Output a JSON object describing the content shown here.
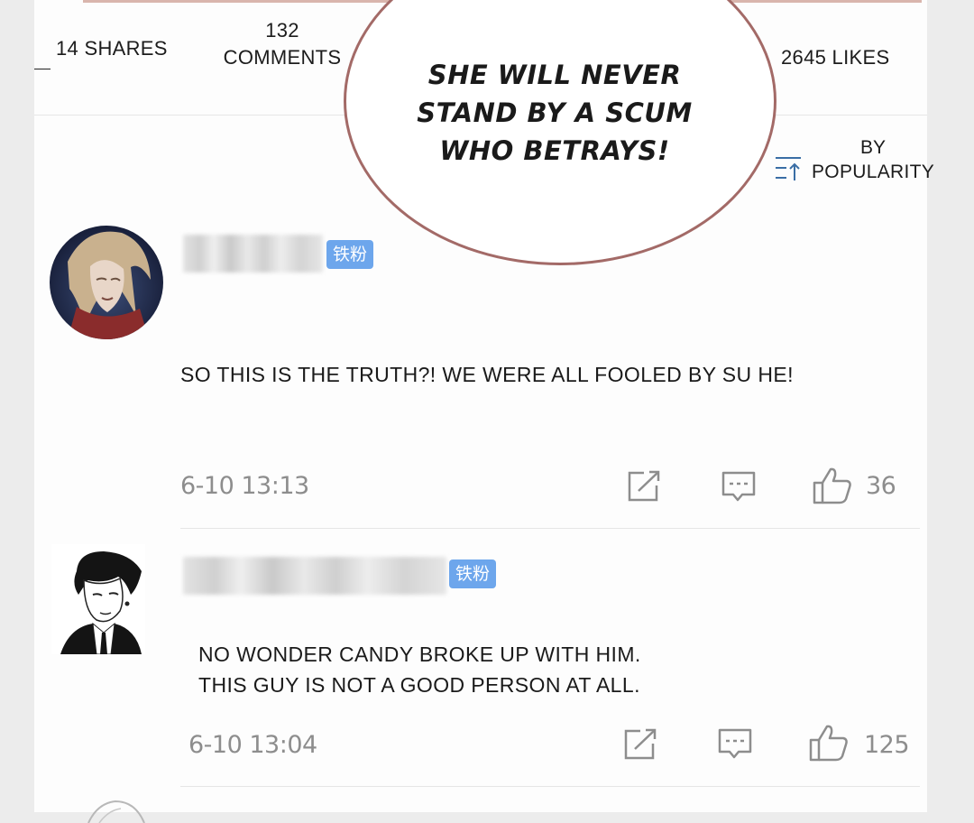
{
  "stats": {
    "shares": "14 SHARES",
    "comments_count": "132",
    "comments_label": "COMMENTS",
    "likes": "2645 LIKES"
  },
  "speech_bubble": {
    "line1": "SHE WILL NEVER",
    "line2": "STAND BY A SCUM",
    "line3": "WHO BETRAYS!"
  },
  "sort": {
    "by": "BY",
    "label": "POPULARITY",
    "icon": "sort-icon"
  },
  "comments": [
    {
      "badge": "铁粉",
      "text": "SO THIS IS THE TRUTH?! WE WERE ALL FOOLED BY SU HE!",
      "timestamp": "6-10 13:13",
      "likes": "36"
    },
    {
      "badge": "铁粉",
      "text_line1": "NO WONDER CANDY BROKE UP WITH HIM.",
      "text_line2": "THIS GUY IS NOT A GOOD PERSON AT ALL.",
      "timestamp": "6-10 13:04",
      "likes": "125"
    }
  ],
  "colors": {
    "badge": "#6da6ec",
    "bubble_border": "#a36a67",
    "muted_text": "#8d8d8d",
    "sort_icon": "#3a6ea5"
  }
}
